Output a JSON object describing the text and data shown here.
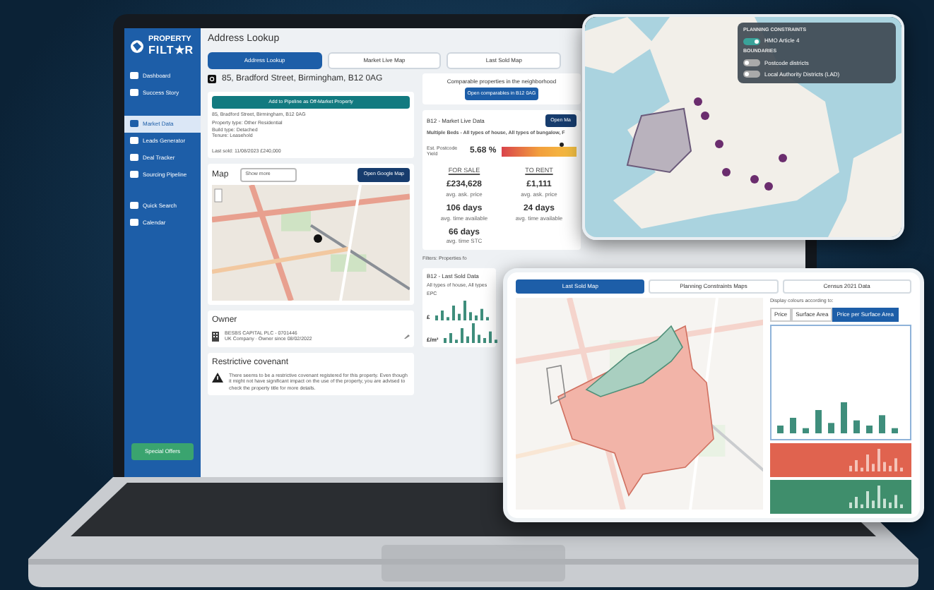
{
  "sidebar": {
    "logo_top": "PROPERTY",
    "logo_bottom": "FILT★R",
    "items": [
      {
        "label": "Dashboard",
        "selected": false
      },
      {
        "label": "Success Story",
        "selected": false
      },
      {
        "label": "Market Data",
        "selected": true
      },
      {
        "label": "Leads Generator",
        "selected": false
      },
      {
        "label": "Deal Tracker",
        "selected": false
      },
      {
        "label": "Sourcing Pipeline",
        "selected": false
      },
      {
        "label": "Quick Search",
        "selected": false
      },
      {
        "label": "Calendar",
        "selected": false
      }
    ],
    "offers_button": "Special Offers"
  },
  "page_title": "Address Lookup",
  "tabs": [
    {
      "label": "Address Lookup",
      "selected": true
    },
    {
      "label": "Market Live Map",
      "selected": false
    },
    {
      "label": "Last Sold Map",
      "selected": false
    }
  ],
  "address": {
    "title": "85, Bradford Street, Birmingham, B12 0AG",
    "pipeline_button": "Add to Pipeline as Off-Market Property",
    "full_address": "85, Bradford Street, Birmingham, B12 0AG",
    "details": [
      "Property type: Other Residential",
      "Build type: Detached",
      "Tenure: Leasehold"
    ],
    "last_sold": "Last sold: 11/08/2023 £240,000"
  },
  "map": {
    "title": "Map",
    "select": "Show more",
    "button": "Open Google Map"
  },
  "owner": {
    "title": "Owner",
    "name": "BESBS CAPITAL PLC - 0701446",
    "detail": "UK Company · Owner since 08/02/2022"
  },
  "covenant": {
    "title": "Restrictive covenant",
    "text": "There seems to be a restrictive covenant registered for this property. Even though it might not have significant impact on the use of the property, you are advised to check the property title for more details."
  },
  "comparables": {
    "title": "Comparable properties in the neighborhood",
    "button": "Open comparables in B12 0AG"
  },
  "market_live": {
    "title": "B12 - Market Live Data",
    "button": "Open Ma",
    "filter": "Multiple Beds - All types of house, All types of bungalow, F",
    "yield_label": "Est. Postcode Yield",
    "yield": "5.68 %",
    "level": 0.8,
    "columns": [
      {
        "heading": "FOR SALE",
        "stats": [
          {
            "value": "£234,628",
            "label": "avg. ask. price"
          },
          {
            "value": "106 days",
            "label": "avg. time available"
          },
          {
            "value": "66 days",
            "label": "avg. time STC"
          }
        ]
      },
      {
        "heading": "TO RENT",
        "stats": [
          {
            "value": "£1,111",
            "label": "avg. ask. price"
          },
          {
            "value": "24 days",
            "label": "avg. time available"
          }
        ]
      }
    ],
    "filters": "Filters: Properties fo"
  },
  "last_sold": {
    "title": "B12 - Last Sold Data",
    "filter": "All types of house, All types",
    "epc": "EPC",
    "axis_labels": [
      "£",
      "£/m²"
    ]
  },
  "constraints_card": {
    "sections": [
      {
        "title": "PLANNING CONSTRAINTS",
        "toggles": [
          {
            "label": "HMO Article 4",
            "on": true
          }
        ]
      },
      {
        "title": "BOUNDARIES",
        "toggles": [
          {
            "label": "Postcode districts",
            "on": false
          },
          {
            "label": "Local Authority Districts (LAD)",
            "on": false
          }
        ]
      }
    ]
  },
  "sold_map_card": {
    "tabs": [
      {
        "label": "Last Sold Map",
        "selected": true
      },
      {
        "label": "Planning Constraints Maps",
        "selected": false
      },
      {
        "label": "Census 2021 Data",
        "selected": false
      }
    ],
    "colour_label": "Display colours according to:",
    "colour_options": [
      {
        "label": "Price",
        "selected": false
      },
      {
        "label": "Surface Area",
        "selected": false
      },
      {
        "label": "Price per Surface Area",
        "selected": true
      }
    ]
  }
}
